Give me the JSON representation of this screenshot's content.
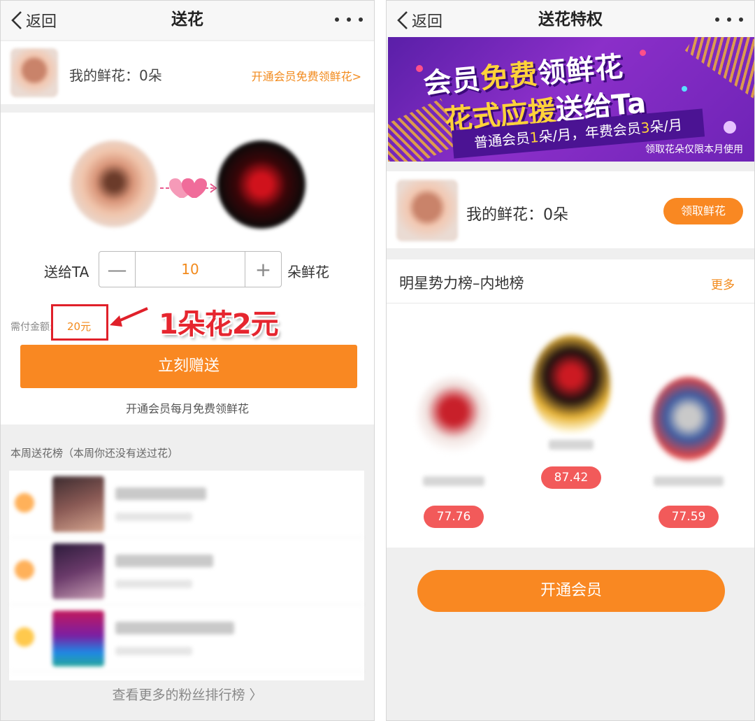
{
  "left": {
    "nav": {
      "back_label": "返回",
      "title": "送花"
    },
    "my_flowers": {
      "label": "我的鲜花：0朵",
      "vip_link": "开通会员免费领鲜花>"
    },
    "send": {
      "prefix_label": "送给TA",
      "minus_symbol": "—",
      "quantity": "10",
      "plus_symbol": "+",
      "unit_label": "朵鲜花",
      "pay_label": "需付金额:",
      "pay_value": "20元",
      "annotation": "1朵花2元",
      "send_button": "立刻赠送",
      "vip_hint": "开通会员每月免费领鲜花"
    },
    "weekly_rank": {
      "header": "本周送花榜（本周你还没有送过花）",
      "more_link": "查看更多的粉丝排行榜 〉"
    }
  },
  "right": {
    "nav": {
      "back_label": "返回",
      "title": "送花特权"
    },
    "banner": {
      "line1_a": "会员",
      "line1_b": "免费",
      "line1_c": "领鲜花",
      "line2_a": "花式应援",
      "line2_b": "送给Ta",
      "ribbon_a": "普通会员",
      "ribbon_b": "1",
      "ribbon_c": "朵/月，年费会员",
      "ribbon_d": "3",
      "ribbon_e": "朵/月",
      "note": "领取花朵仅限本月使用"
    },
    "my_flowers": {
      "label": "我的鲜花：0朵",
      "claim_button": "领取鲜花"
    },
    "star_rank": {
      "title": "明星势力榜–内地榜",
      "more": "更多",
      "scores": [
        "77.76",
        "87.42",
        "77.59"
      ]
    },
    "open_vip_button": "开通会员"
  },
  "colors": {
    "accent_orange": "#f98822",
    "link_orange": "#f28a1c",
    "score_red": "#f25a5a",
    "annotation_red": "#e6262f",
    "banner_purple": "#6e23b6"
  },
  "icons": [
    "chevron-left-icon",
    "more-dots-icon",
    "hearts-icon",
    "arrow-icon"
  ]
}
